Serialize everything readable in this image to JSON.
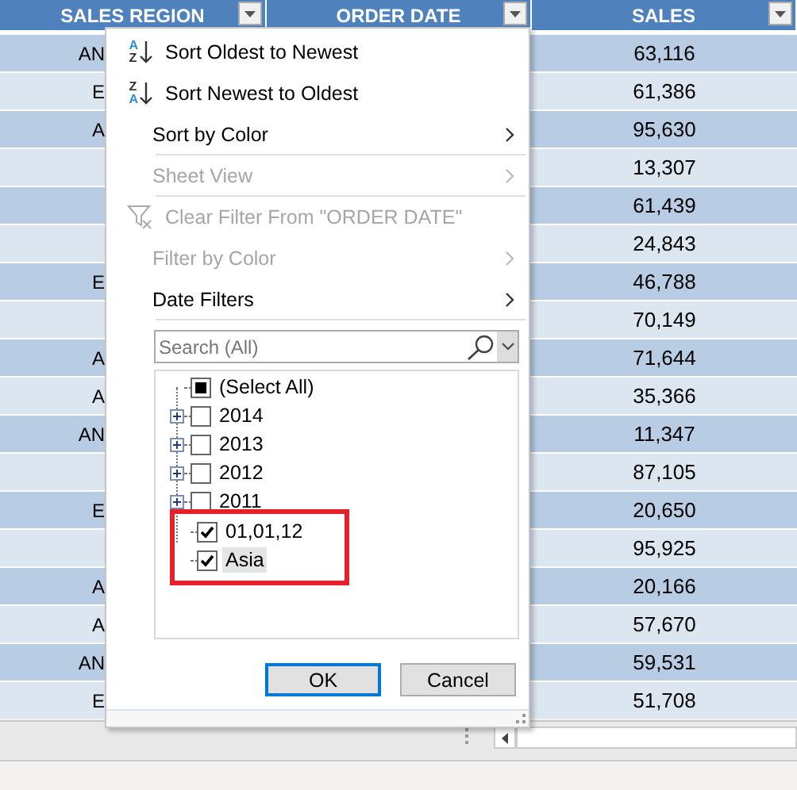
{
  "table": {
    "columns": [
      {
        "title": "SALES REGION"
      },
      {
        "title": "ORDER DATE"
      },
      {
        "title": "SALES"
      }
    ],
    "rows": [
      {
        "region": "AN",
        "sales": "63,116"
      },
      {
        "region": "E",
        "sales": "61,386"
      },
      {
        "region": "A",
        "sales": "95,630"
      },
      {
        "sales": "13,307"
      },
      {
        "sales": "61,439"
      },
      {
        "sales": "24,843"
      },
      {
        "region": "E",
        "sales": "46,788"
      },
      {
        "sales": "70,149"
      },
      {
        "region": "A",
        "sales": "71,644"
      },
      {
        "region": "A",
        "sales": "35,366"
      },
      {
        "region": "AN",
        "sales": "11,347"
      },
      {
        "sales": "87,105"
      },
      {
        "region": "E",
        "sales": "20,650"
      },
      {
        "sales": "95,925"
      },
      {
        "region": "A",
        "sales": "20,166"
      },
      {
        "region": "A",
        "sales": "57,670"
      },
      {
        "region": "AN",
        "sales": "59,531"
      },
      {
        "region": "E",
        "sales": "51,708"
      }
    ]
  },
  "filter_menu": {
    "items": [
      {
        "kind": "sort-asc",
        "label": "Sort Oldest to Newest",
        "icon_letters": [
          "A",
          "Z"
        ],
        "disabled": false,
        "submenu": false,
        "separator_after": false
      },
      {
        "kind": "sort-desc",
        "label": "Sort Newest to Oldest",
        "icon_letters": [
          "Z",
          "A"
        ],
        "disabled": false,
        "submenu": false,
        "separator_after": false
      },
      {
        "kind": "plain",
        "label": "Sort by Color",
        "disabled": false,
        "submenu": true,
        "separator_after": true
      },
      {
        "kind": "plain",
        "label": "Sheet View",
        "disabled": true,
        "submenu": true,
        "separator_after": true
      },
      {
        "kind": "clear-filter",
        "label": "Clear Filter From \"ORDER DATE\"",
        "disabled": true,
        "submenu": false,
        "separator_after": false
      },
      {
        "kind": "plain",
        "label": "Filter by Color",
        "disabled": true,
        "submenu": true,
        "separator_after": false
      },
      {
        "kind": "plain",
        "label": "Date Filters",
        "disabled": false,
        "submenu": true,
        "separator_after": true
      }
    ],
    "search": {
      "placeholder": "Search (All)"
    },
    "values": [
      {
        "label": "(Select All)",
        "checked": false,
        "indeterminate": true,
        "expandable": false,
        "selected": false,
        "boxed": false
      },
      {
        "label": "2014",
        "checked": false,
        "indeterminate": false,
        "expandable": true,
        "selected": false,
        "boxed": false
      },
      {
        "label": "2013",
        "checked": false,
        "indeterminate": false,
        "expandable": true,
        "selected": false,
        "boxed": false
      },
      {
        "label": "2012",
        "checked": false,
        "indeterminate": false,
        "expandable": true,
        "selected": false,
        "boxed": false
      },
      {
        "label": "2011",
        "checked": false,
        "indeterminate": false,
        "expandable": true,
        "selected": false,
        "boxed": false
      },
      {
        "label": "01,01,12",
        "checked": true,
        "indeterminate": false,
        "expandable": false,
        "selected": false,
        "boxed": true
      },
      {
        "label": "Asia",
        "checked": true,
        "indeterminate": false,
        "expandable": false,
        "selected": true,
        "boxed": true
      }
    ],
    "buttons": [
      {
        "label": "OK",
        "default": true
      },
      {
        "label": "Cancel",
        "default": false
      }
    ]
  }
}
